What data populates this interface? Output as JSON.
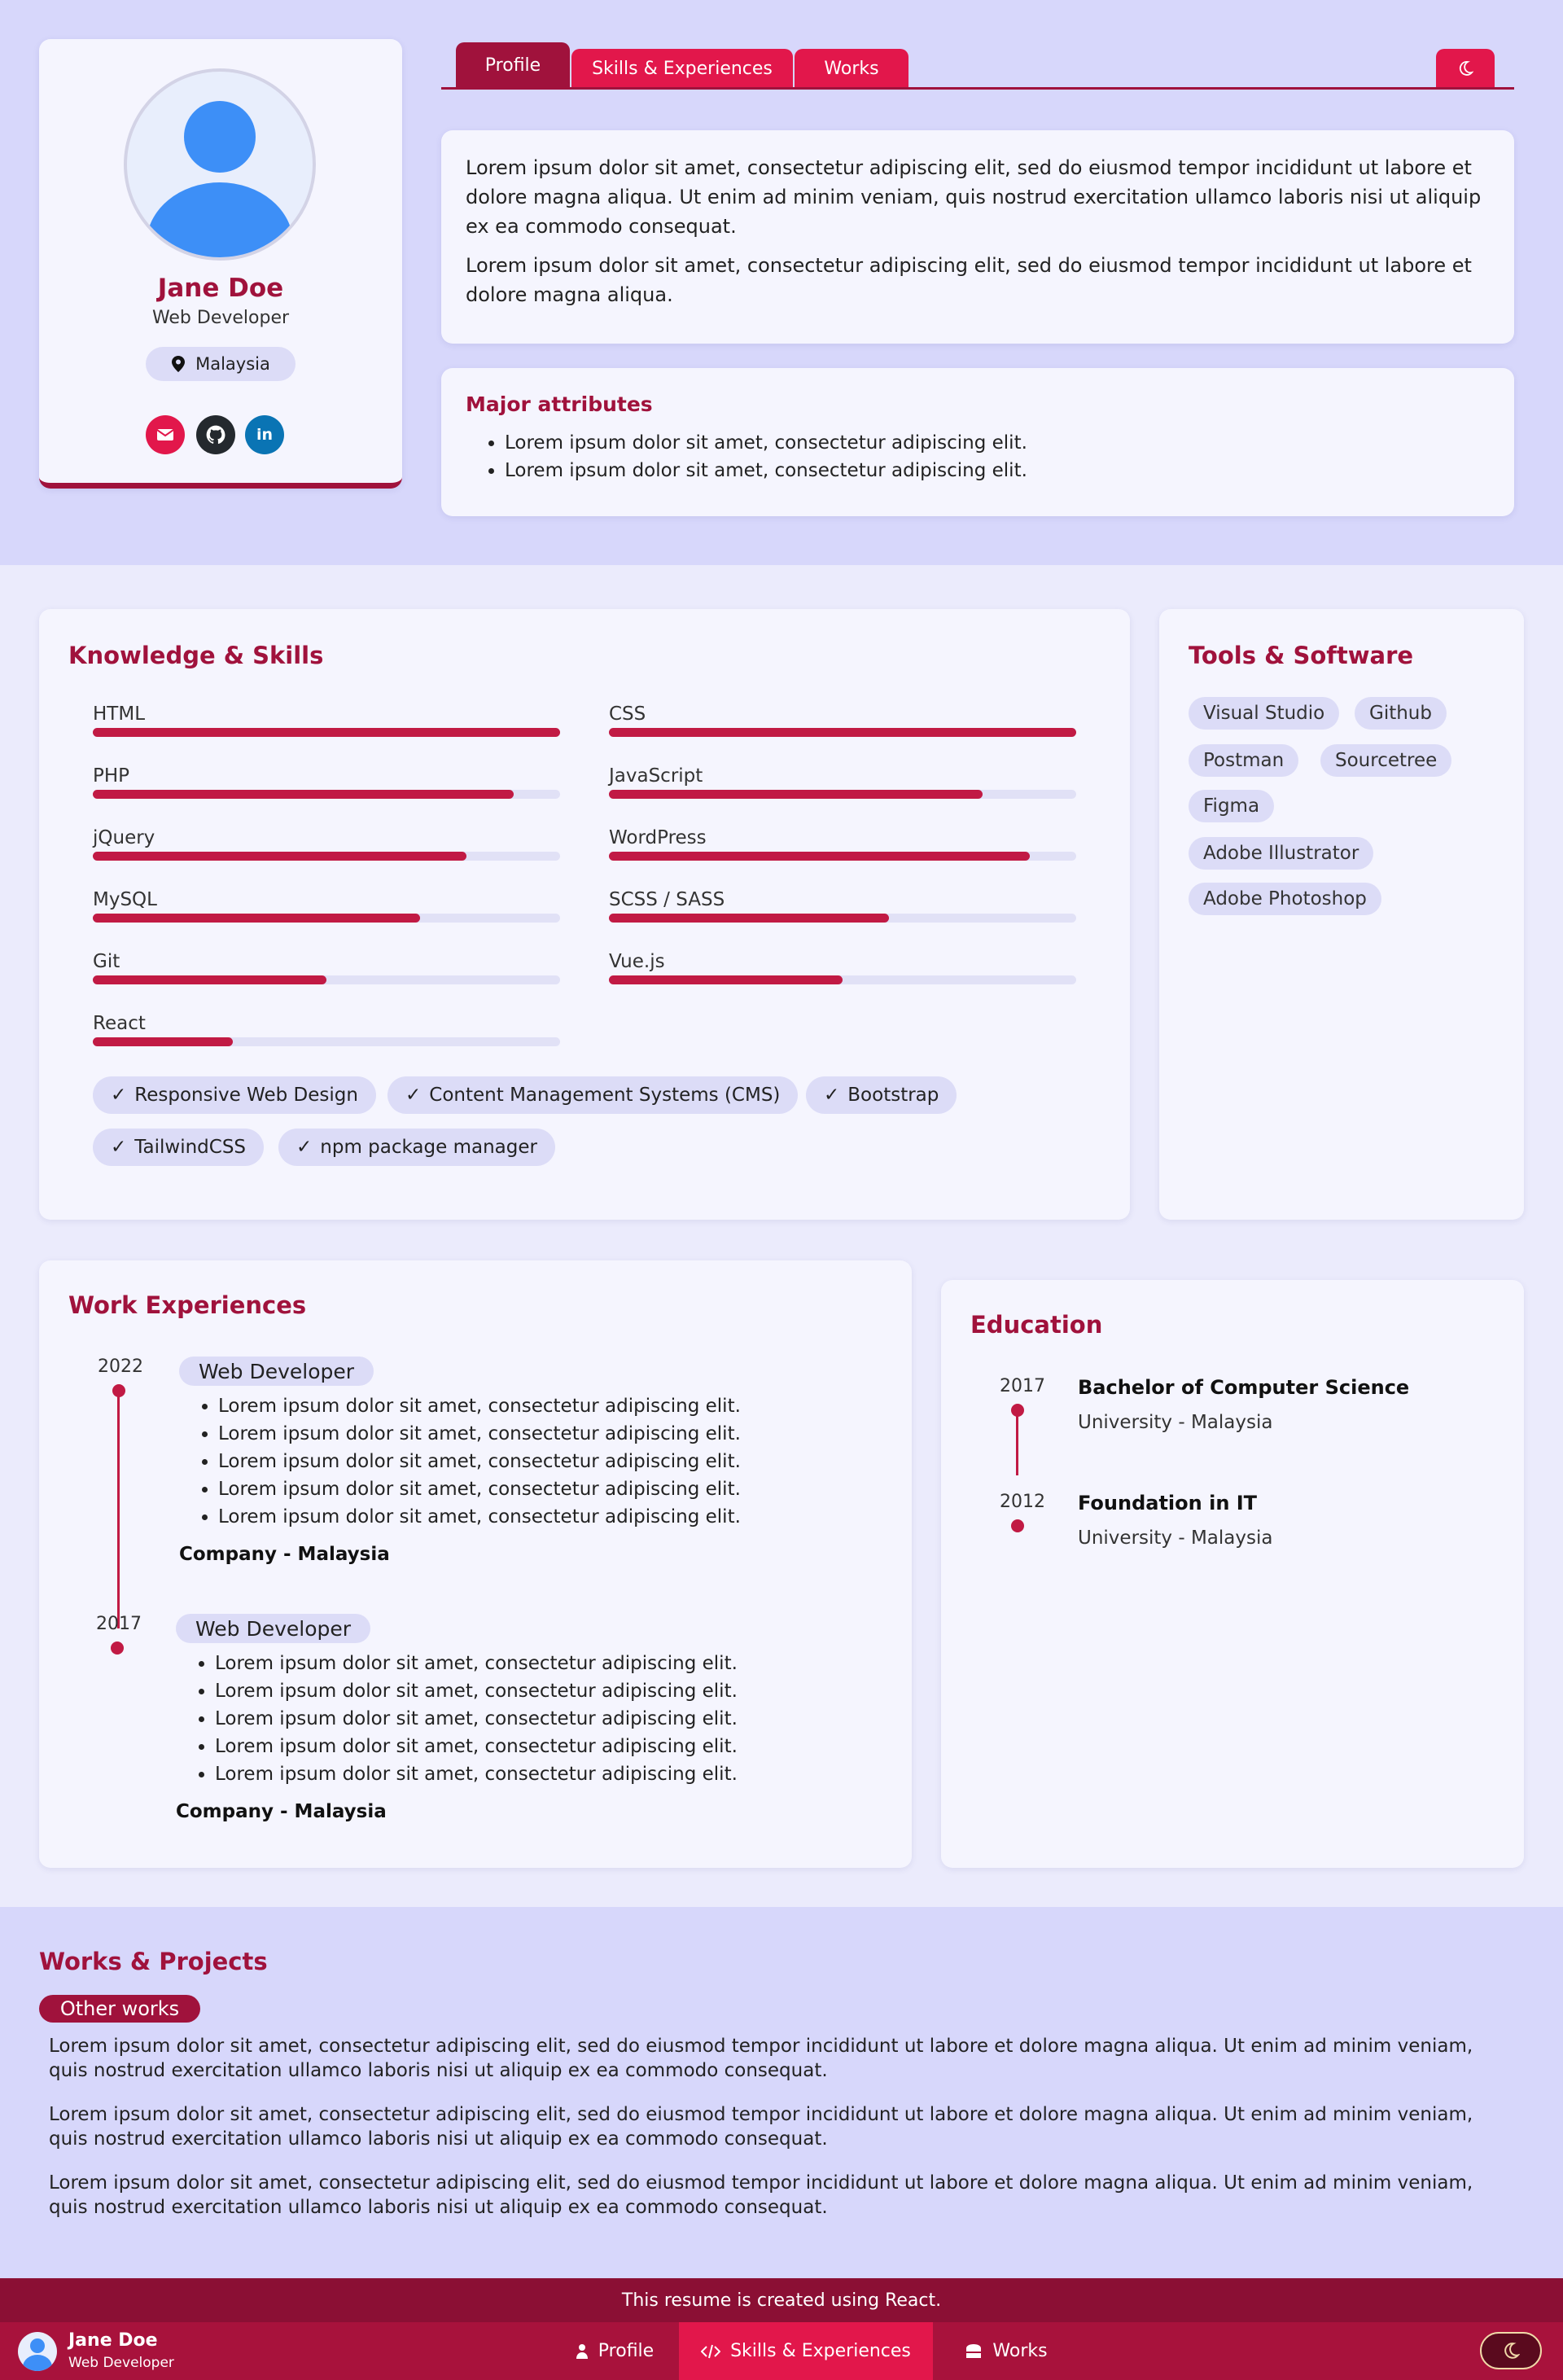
{
  "profile": {
    "name": "Jane Doe",
    "role": "Web Developer",
    "location": "Malaysia",
    "social": [
      "email-icon",
      "github-icon",
      "linkedin-icon"
    ]
  },
  "tabs": [
    {
      "label": "Profile",
      "active": true
    },
    {
      "label": "Skills & Experiences",
      "active": false
    },
    {
      "label": "Works",
      "active": false
    }
  ],
  "intro": {
    "paragraphs": [
      "Lorem ipsum dolor sit amet, consectetur adipiscing elit, sed do eiusmod tempor incididunt ut labore et dolore magna aliqua. Ut enim ad minim veniam, quis nostrud exercitation ullamco laboris nisi ut aliquip ex ea commodo consequat.",
      "Lorem ipsum dolor sit amet, consectetur adipiscing elit, sed do eiusmod tempor incididunt ut labore et dolore magna aliqua."
    ]
  },
  "attributes": {
    "title": "Major attributes",
    "items": [
      "Lorem ipsum dolor sit amet, consectetur adipiscing elit.",
      "Lorem ipsum dolor sit amet, consectetur adipiscing elit."
    ]
  },
  "skills": {
    "title": "Knowledge & Skills",
    "items": [
      {
        "name": "HTML",
        "level": 1.0
      },
      {
        "name": "CSS",
        "level": 1.0
      },
      {
        "name": "PHP",
        "level": 0.9
      },
      {
        "name": "JavaScript",
        "level": 0.8
      },
      {
        "name": "jQuery",
        "level": 0.8
      },
      {
        "name": "WordPress",
        "level": 0.9
      },
      {
        "name": "MySQL",
        "level": 0.7
      },
      {
        "name": "SCSS / SASS",
        "level": 0.6
      },
      {
        "name": "Git",
        "level": 0.5
      },
      {
        "name": "Vue.js",
        "level": 0.5
      },
      {
        "name": "React",
        "level": 0.3
      }
    ],
    "chips": [
      "Responsive Web Design",
      "Content Management Systems (CMS)",
      "Bootstrap",
      "TailwindCSS",
      "npm package manager"
    ]
  },
  "tools": {
    "title": "Tools & Software",
    "items": [
      "Visual Studio",
      "Github",
      "Postman",
      "Sourcetree",
      "Figma",
      "Adobe Illustrator",
      "Adobe Photoshop"
    ]
  },
  "work": {
    "title": "Work Experiences",
    "jobs": [
      {
        "year": "2022",
        "title": "Web Developer",
        "duties": [
          "Lorem ipsum dolor sit amet, consectetur adipiscing elit.",
          "Lorem ipsum dolor sit amet, consectetur adipiscing elit.",
          "Lorem ipsum dolor sit amet, consectetur adipiscing elit.",
          "Lorem ipsum dolor sit amet, consectetur adipiscing elit.",
          "Lorem ipsum dolor sit amet, consectetur adipiscing elit."
        ],
        "company": "Company - Malaysia"
      },
      {
        "year": "2017",
        "title": "Web Developer",
        "duties": [
          "Lorem ipsum dolor sit amet, consectetur adipiscing elit.",
          "Lorem ipsum dolor sit amet, consectetur adipiscing elit.",
          "Lorem ipsum dolor sit amet, consectetur adipiscing elit.",
          "Lorem ipsum dolor sit amet, consectetur adipiscing elit.",
          "Lorem ipsum dolor sit amet, consectetur adipiscing elit."
        ],
        "company": "Company - Malaysia"
      }
    ]
  },
  "education": {
    "title": "Education",
    "items": [
      {
        "year": "2017",
        "degree": "Bachelor of Computer Science",
        "school": "University - Malaysia"
      },
      {
        "year": "2012",
        "degree": "Foundation in IT",
        "school": "University - Malaysia"
      }
    ]
  },
  "works": {
    "title": "Works & Projects",
    "pill": "Other works",
    "paragraphs": [
      "Lorem ipsum dolor sit amet, consectetur adipiscing elit, sed do eiusmod tempor incididunt ut labore et dolore magna aliqua. Ut enim ad minim veniam, quis nostrud exercitation ullamco laboris nisi ut aliquip ex ea commodo consequat.",
      "Lorem ipsum dolor sit amet, consectetur adipiscing elit, sed do eiusmod tempor incididunt ut labore et dolore magna aliqua. Ut enim ad minim veniam, quis nostrud exercitation ullamco laboris nisi ut aliquip ex ea commodo consequat.",
      "Lorem ipsum dolor sit amet, consectetur adipiscing elit, sed do eiusmod tempor incididunt ut labore et dolore magna aliqua. Ut enim ad minim veniam, quis nostrud exercitation ullamco laboris nisi ut aliquip ex ea commodo consequat."
    ]
  },
  "footer": {
    "note": "This resume is created using React.",
    "name": "Jane Doe",
    "role": "Web Developer",
    "nav": [
      {
        "label": "Profile",
        "icon": "person-icon"
      },
      {
        "label": "Skills & Experiences",
        "icon": "code-icon"
      },
      {
        "label": "Works",
        "icon": "cap-icon"
      }
    ],
    "active_nav": "Skills & Experiences",
    "theme_icon": "moon-icon"
  },
  "colors": {
    "accent": "#a0123c",
    "accent_bright": "#e2174b",
    "bar_fill": "#c11a44",
    "bg": "#d7d7fb",
    "card": "#f5f5fe"
  }
}
